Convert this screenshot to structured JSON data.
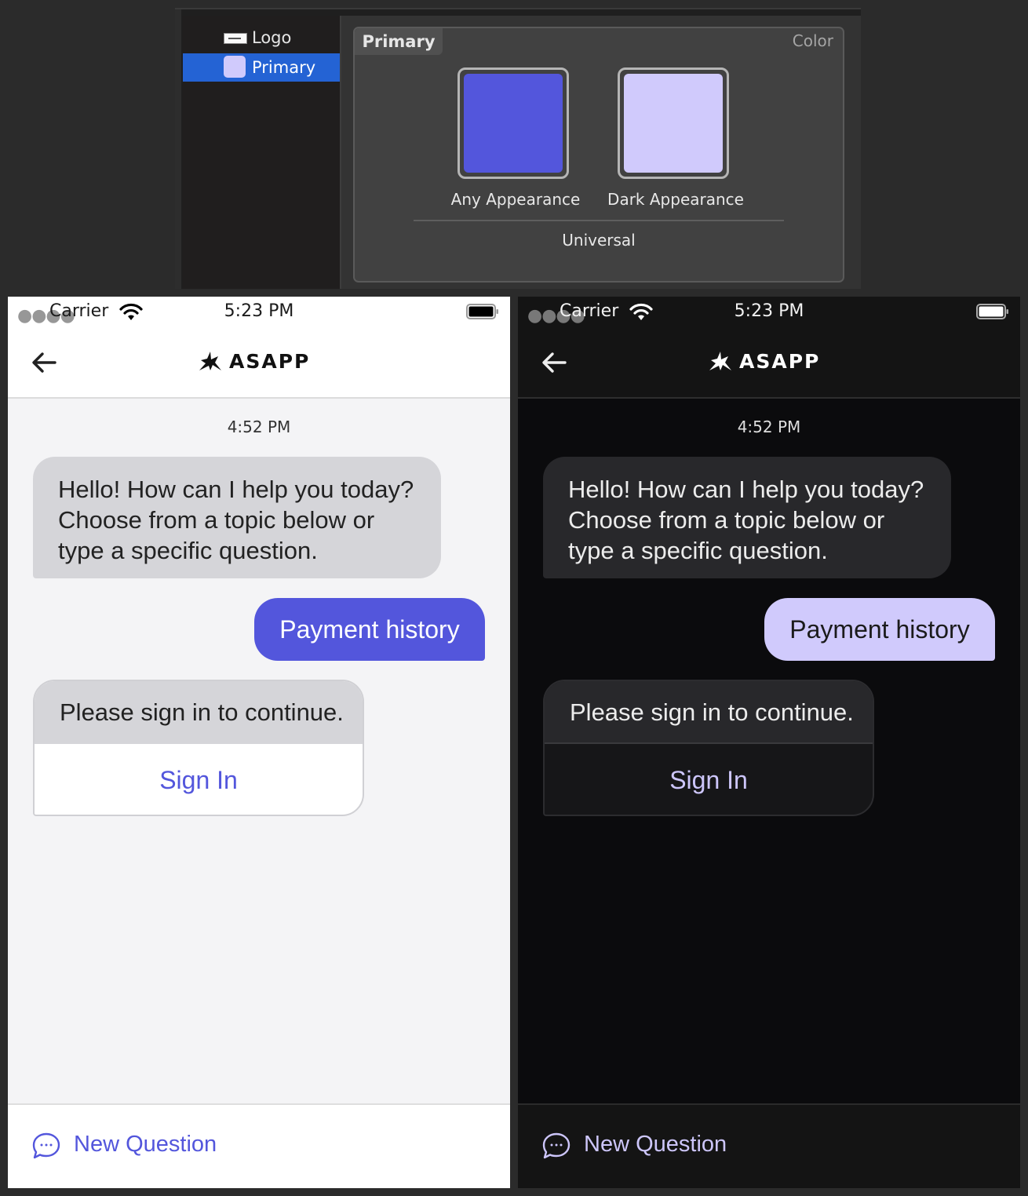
{
  "colors": {
    "primary_any": "#5356dc",
    "primary_dark": "#d0cafc",
    "selection": "#2463d4"
  },
  "asset_catalog": {
    "sidebar": {
      "items": [
        {
          "label": "Logo",
          "icon": "image-thumbnail-icon"
        },
        {
          "label": "Primary",
          "icon": "color-swatch-icon",
          "selected": true
        }
      ]
    },
    "asset_name": "Primary",
    "asset_type": "Color",
    "appearances": [
      {
        "label": "Any Appearance"
      },
      {
        "label": "Dark Appearance"
      }
    ],
    "device_label": "Universal"
  },
  "phone": {
    "status": {
      "carrier": "Carrier",
      "time": "5:23 PM"
    },
    "brand": "ASAPP",
    "timestamp": "4:52 PM",
    "agent_message": "Hello! How can I help you today? Choose from a topic below or type a specific question.",
    "user_message": "Payment history",
    "signin_prompt": "Please sign in to continue.",
    "signin_button": "Sign In",
    "new_question": "New Question"
  }
}
